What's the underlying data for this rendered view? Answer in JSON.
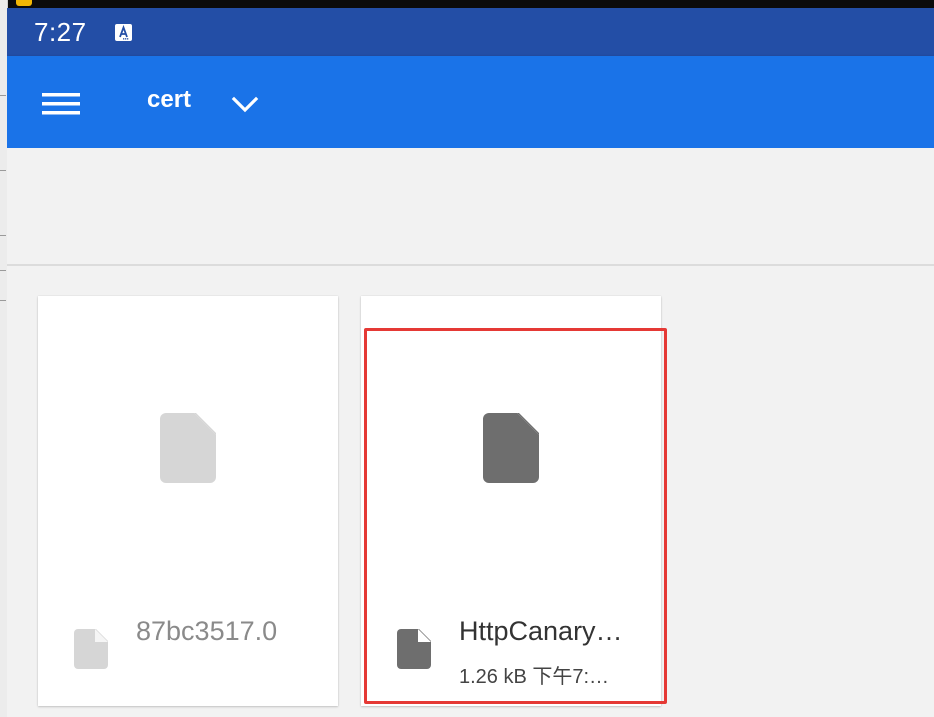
{
  "status_bar": {
    "time": "7:27",
    "notification_icon": "a-text-icon"
  },
  "app_bar": {
    "menu_icon": "hamburger-menu-icon",
    "folder_title": "cert",
    "dropdown_icon": "chevron-down-icon"
  },
  "files": [
    {
      "name": "87bc3517.0",
      "meta": "",
      "icon": "file-icon",
      "icon_color": "#d6d6d6"
    },
    {
      "name": "HttpCanary…",
      "meta": "1.26 kB 下午7:…",
      "icon": "file-icon",
      "icon_color": "#6e6e6e"
    }
  ],
  "colors": {
    "status_bar": "#234ea6",
    "app_bar": "#1a73e8",
    "highlight": "#e53935",
    "background": "#f2f2f2"
  }
}
